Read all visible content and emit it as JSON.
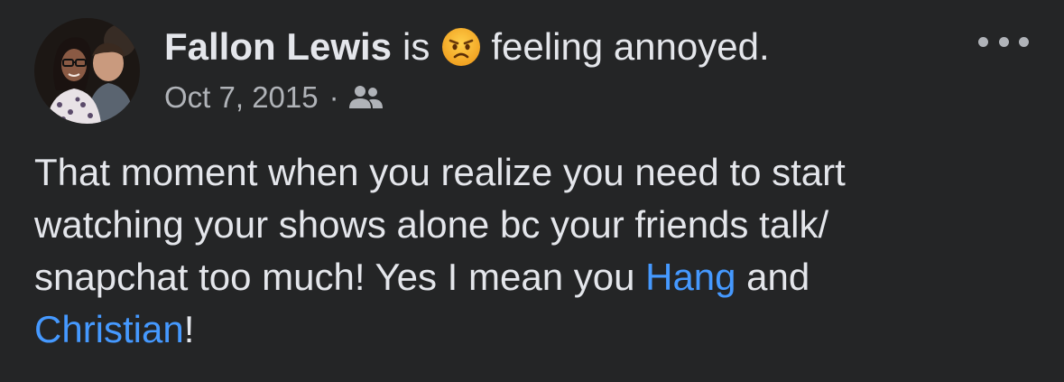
{
  "post": {
    "author": "Fallon Lewis",
    "is_word": "is",
    "feeling_emoji": "angry-face-icon",
    "feeling_text": "feeling annoyed.",
    "date": "Oct 7, 2015",
    "separator": "·",
    "audience_icon": "friends-icon",
    "more_icon": "more-options-icon",
    "body_lines": [
      "That moment when you realize you need to start",
      "watching your shows alone bc your friends talk/",
      "snapchat too much! Yes I mean you ",
      " and",
      "!"
    ],
    "mentions": [
      "Hang",
      "Christian"
    ],
    "colors": {
      "background": "#242526",
      "text": "#e4e6eb",
      "secondary": "#b0b3b8",
      "link": "#4599ff"
    }
  }
}
